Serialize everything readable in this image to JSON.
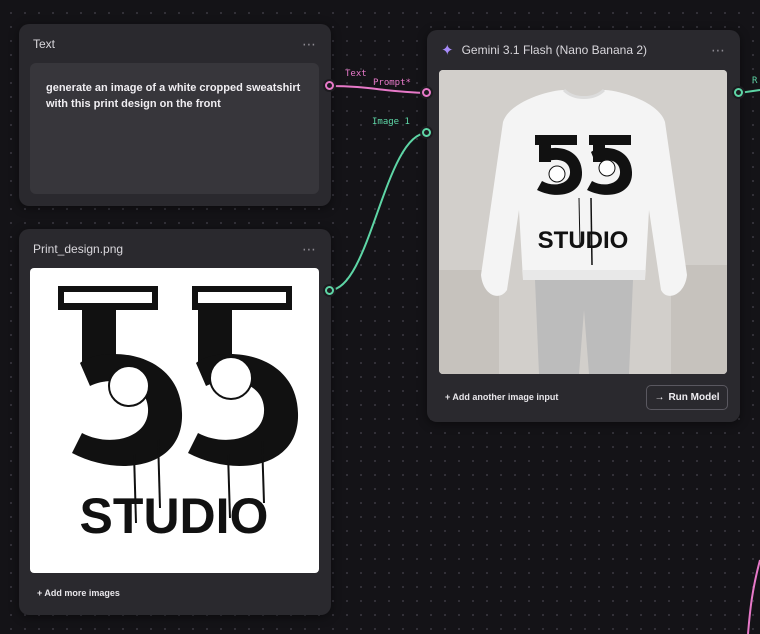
{
  "text_node": {
    "title": "Text",
    "menu": "⋯",
    "prompt": "generate an image of a white cropped sweatshirt with this print design on the front"
  },
  "print_node": {
    "title": "Print_design.png",
    "menu": "⋯",
    "add_more": "+ Add more images",
    "design_number": "55",
    "design_word": "STUDIO"
  },
  "gemini_node": {
    "title": "Gemini 3.1 Flash (Nano Banana 2)",
    "menu": "⋯",
    "add_input": "+  Add another image input",
    "run_arrow": "→",
    "run_label": "Run Model",
    "result_number": "55",
    "result_word": "STUDIO"
  },
  "edges": {
    "text_label": "Text",
    "prompt_label": "Prompt*",
    "image_label": "Image 1",
    "result_label": "R"
  },
  "colors": {
    "text_edge": "#e879c9",
    "image_edge": "#5ed6a6",
    "node_bg": "#2a292e",
    "canvas_bg": "#141317"
  },
  "icons": {
    "gemini": "sparkle-icon",
    "run": "arrow-right-icon",
    "menu": "more-horizontal-icon"
  }
}
